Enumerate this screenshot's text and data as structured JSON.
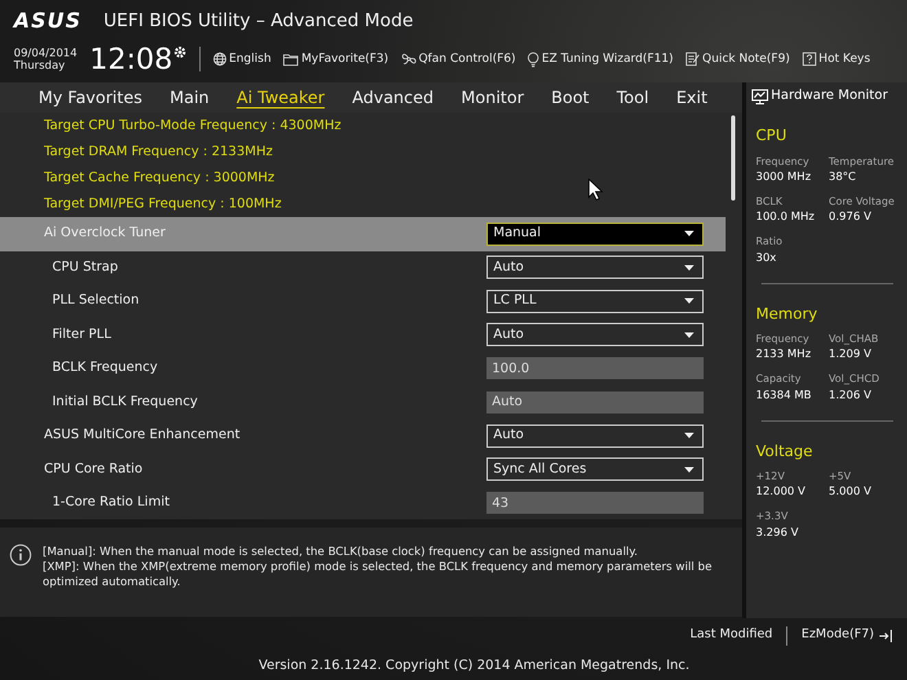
{
  "window": {
    "logo": "ASUS",
    "title": "UEFI BIOS Utility – Advanced Mode"
  },
  "clock": {
    "date": "09/04/2014",
    "day": "Thursday",
    "time": "12:08"
  },
  "toolbar": [
    {
      "kind": "globe",
      "label": "English"
    },
    {
      "kind": "folder",
      "label": "MyFavorite(F3)"
    },
    {
      "kind": "fan",
      "label": "Qfan Control(F6)"
    },
    {
      "kind": "bulb",
      "label": "EZ Tuning Wizard(F11)"
    },
    {
      "kind": "note",
      "label": "Quick Note(F9)"
    },
    {
      "kind": "help",
      "label": "Hot Keys"
    }
  ],
  "tabs": [
    {
      "label": "My Favorites",
      "selected": false
    },
    {
      "label": "Main",
      "selected": false
    },
    {
      "label": "Ai Tweaker",
      "selected": true
    },
    {
      "label": "Advanced",
      "selected": false
    },
    {
      "label": "Monitor",
      "selected": false
    },
    {
      "label": "Boot",
      "selected": false
    },
    {
      "label": "Tool",
      "selected": false
    },
    {
      "label": "Exit",
      "selected": false
    }
  ],
  "targets": [
    "Target CPU Turbo-Mode Frequency : 4300MHz",
    "Target DRAM Frequency : 2133MHz",
    "Target Cache Frequency : 3000MHz",
    "Target DMI/PEG Frequency : 100MHz"
  ],
  "settings": [
    {
      "label": "Ai Overclock Tuner",
      "kind": "dropdown",
      "value": "Manual",
      "selected": true,
      "children": [
        {
          "label": "CPU Strap",
          "kind": "dropdown",
          "value": "Auto",
          "selected": false
        },
        {
          "label": "PLL Selection",
          "kind": "dropdown",
          "value": "LC PLL",
          "selected": false
        },
        {
          "label": "Filter PLL",
          "kind": "dropdown",
          "value": "Auto",
          "selected": false
        },
        {
          "label": "BCLK Frequency",
          "kind": "input",
          "value": "100.0",
          "selected": false
        },
        {
          "label": "Initial BCLK Frequency",
          "kind": "input",
          "value": "Auto",
          "selected": false
        }
      ]
    },
    {
      "label": "ASUS MultiCore Enhancement",
      "kind": "dropdown",
      "value": "Auto",
      "selected": false
    },
    {
      "label": "CPU Core Ratio",
      "kind": "dropdown",
      "value": "Sync All Cores",
      "selected": false,
      "children": [
        {
          "label": "1-Core Ratio Limit",
          "kind": "input",
          "value": "43",
          "selected": false
        }
      ]
    }
  ],
  "help": [
    "[Manual]: When the manual mode is selected, the BCLK(base clock) frequency can be assigned manually.",
    "[XMP]: When the XMP(extreme memory profile) mode is selected, the BCLK frequency and memory parameters will be optimized automatically."
  ],
  "hardware_monitor": {
    "title": "Hardware Monitor",
    "sections": [
      {
        "title": "CPU",
        "readings": [
          {
            "label": "Frequency",
            "value": "3000 MHz"
          },
          {
            "label": "Temperature",
            "value": "38°C"
          },
          {
            "label": "BCLK",
            "value": "100.0 MHz"
          },
          {
            "label": "Core Voltage",
            "value": "0.976 V"
          },
          {
            "label": "Ratio",
            "value": "30x"
          }
        ]
      },
      {
        "title": "Memory",
        "readings": [
          {
            "label": "Frequency",
            "value": "2133 MHz"
          },
          {
            "label": "Vol_CHAB",
            "value": "1.209 V"
          },
          {
            "label": "Capacity",
            "value": "16384 MB"
          },
          {
            "label": "Vol_CHCD",
            "value": "1.206 V"
          }
        ]
      },
      {
        "title": "Voltage",
        "readings": [
          {
            "label": "+12V",
            "value": "12.000 V"
          },
          {
            "label": "+5V",
            "value": "5.000 V"
          },
          {
            "label": "+3.3V",
            "value": "3.296 V"
          }
        ]
      }
    ]
  },
  "footer": {
    "last_modified": "Last Modified",
    "ez_mode": "EzMode(F7)",
    "version": "Version 2.16.1242. Copyright (C) 2014 American Megatrends, Inc."
  }
}
